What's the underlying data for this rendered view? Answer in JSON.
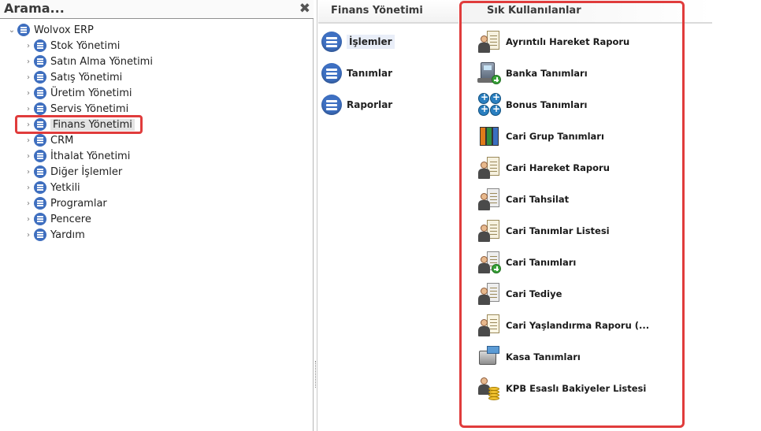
{
  "search": {
    "title": "Arama...",
    "close": "✖"
  },
  "tree": {
    "root": "Wolvox ERP",
    "items": [
      {
        "label": "Stok Yönetimi"
      },
      {
        "label": "Satın Alma Yönetimi"
      },
      {
        "label": "Satış Yönetimi"
      },
      {
        "label": "Üretim Yönetimi"
      },
      {
        "label": "Servis Yönetimi"
      },
      {
        "label": "Finans Yönetimi",
        "selected": true
      },
      {
        "label": "CRM"
      },
      {
        "label": "İthalat Yönetimi"
      },
      {
        "label": "Diğer İşlemler"
      },
      {
        "label": "Yetkili"
      },
      {
        "label": "Programlar"
      },
      {
        "label": "Pencere"
      },
      {
        "label": "Yardım"
      }
    ]
  },
  "finans": {
    "tab_label": "Finans Yönetimi",
    "menu": [
      {
        "label": "İşlemler",
        "active": true
      },
      {
        "label": "Tanımlar"
      },
      {
        "label": "Raporlar"
      }
    ]
  },
  "favorites": {
    "tab_label": "Sık Kullanılanlar",
    "items": [
      {
        "label": "Ayrıntılı Hareket Raporu",
        "icon": "report-icon"
      },
      {
        "label": "Banka Tanımları",
        "icon": "bank-icon"
      },
      {
        "label": "Bonus Tanımları",
        "icon": "bonus-icon"
      },
      {
        "label": "Cari Grup Tanımları",
        "icon": "books-icon"
      },
      {
        "label": "Cari Hareket Raporu",
        "icon": "report-icon"
      },
      {
        "label": "Cari Tahsilat",
        "icon": "receipt-icon"
      },
      {
        "label": "Cari Tanımlar Listesi",
        "icon": "report-icon"
      },
      {
        "label": "Cari Tanımları",
        "icon": "add-account-icon"
      },
      {
        "label": "Cari Tediye",
        "icon": "receipt-icon"
      },
      {
        "label": "Cari Yaşlandırma Raporu (...",
        "icon": "aging-report-icon"
      },
      {
        "label": "Kasa Tanımları",
        "icon": "cash-register-icon"
      },
      {
        "label": "KPB Esaslı Bakiyeler Listesi",
        "icon": "balance-coins-icon"
      }
    ]
  },
  "colors": {
    "highlight": "#e03c3c",
    "menu_icon": "#3e70c2"
  }
}
